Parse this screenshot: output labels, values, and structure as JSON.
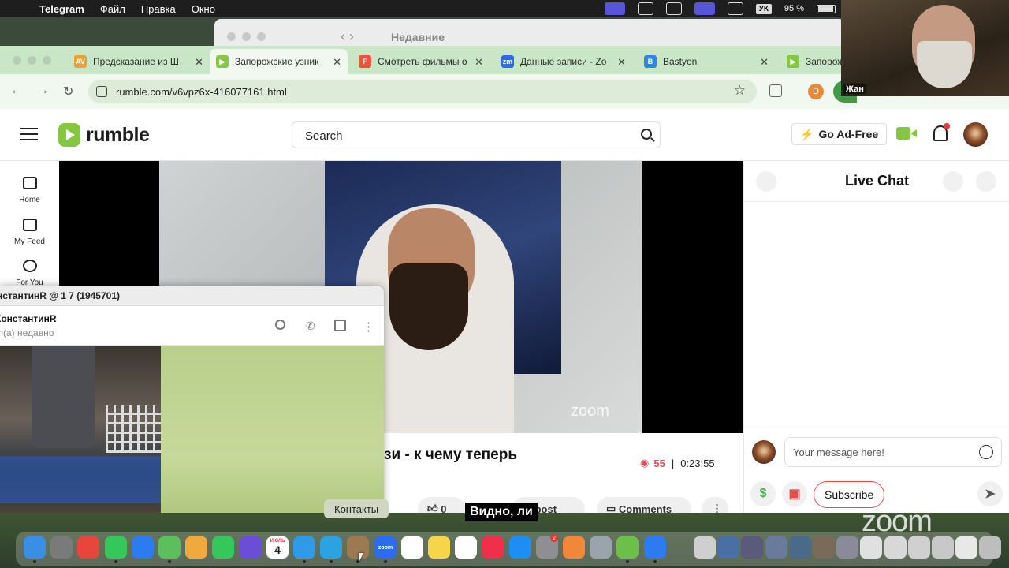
{
  "menubar": {
    "app_name": "Telegram",
    "items": [
      "Файл",
      "Правка",
      "Окно"
    ],
    "keyboard_layout": "УК",
    "battery": "95 %"
  },
  "safari_back": {
    "title": "Недавние"
  },
  "webcam": {
    "name": "Жан"
  },
  "tabs": [
    {
      "label": "Предсказание из Ш",
      "icon": "av-icon",
      "color": "#e8a13a",
      "glyph": "AV"
    },
    {
      "label": "Запорожские узник",
      "icon": "rumble-icon",
      "color": "#85c742",
      "glyph": "▶"
    },
    {
      "label": "Смотреть фильмы о",
      "icon": "film-icon",
      "color": "#e8553a",
      "glyph": "F"
    },
    {
      "label": "Данные записи - Zo",
      "icon": "zoom-icon",
      "color": "#2d6cf0",
      "glyph": "zm"
    },
    {
      "label": "Bastyon",
      "icon": "bastyon-icon",
      "color": "#2f86e0",
      "glyph": "B"
    },
    {
      "label": "Запорож",
      "icon": "rumble-icon",
      "color": "#85c742",
      "glyph": "▶"
    }
  ],
  "address_bar": {
    "url": "rumble.com/v6vpz6x-416077161.html",
    "profile_initial": "D"
  },
  "rumble": {
    "logo_text": "rumble",
    "search_placeholder": "Search",
    "go_ad_free": "Go Ad-Free",
    "sidebar": [
      {
        "label": "Home",
        "icon": "home-icon"
      },
      {
        "label": "My Feed",
        "icon": "feed-icon"
      },
      {
        "label": "For You",
        "icon": "target-icon"
      }
    ],
    "video": {
      "watermark": "zoom",
      "title": "зи - к чему теперь",
      "views": "55",
      "duration": "0:23:55"
    },
    "actions": {
      "likes": "0",
      "repost": "Repost",
      "comments": "Comments"
    },
    "chat": {
      "title": "Live Chat",
      "message_placeholder": "Your message here!",
      "subscribe": "Subscribe"
    }
  },
  "telegram": {
    "window_title": "нстантинR @ 1 7 (1945701)",
    "chat_name": "КонстантинR",
    "status": "л(а) недавно"
  },
  "overlay": {
    "dock_tooltip": "Контакты",
    "subtitle": "Виднo, ли",
    "zoom_logo": "zoom",
    "calendar_day": "4",
    "calendar_month": "ИЮЛЬ",
    "badge_count": "2"
  }
}
